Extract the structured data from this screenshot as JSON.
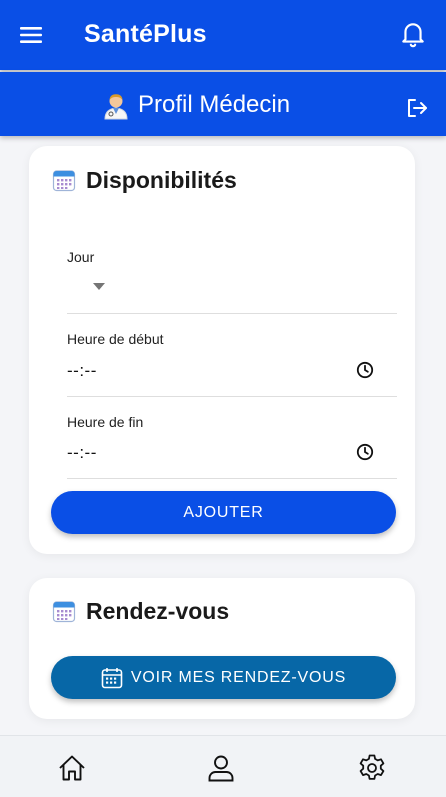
{
  "header": {
    "title": "SantéPlus",
    "menu_icon": "menu-icon",
    "notification_icon": "bell-icon"
  },
  "profile": {
    "emoji": "🧑‍⚕️",
    "title": "Profil Médecin",
    "logout_icon": "logout-icon"
  },
  "availability": {
    "icon": "calendar-icon",
    "title": "Disponibilités",
    "day_label": "Jour",
    "day_value": "",
    "start_label": "Heure de début",
    "start_value": "--:--",
    "end_label": "Heure de fin",
    "end_value": "--:--",
    "add_button": "AJOUTER"
  },
  "appointments": {
    "icon": "calendar-icon",
    "title": "Rendez-vous",
    "view_button": "VOIR MES RENDEZ-VOUS"
  },
  "bottom_nav": {
    "items": [
      {
        "icon": "home-icon"
      },
      {
        "icon": "person-icon"
      },
      {
        "icon": "settings-icon"
      }
    ]
  },
  "colors": {
    "primary": "#0a4fe6",
    "secondary_button": "#0767a7",
    "background": "#f4f5f8"
  }
}
